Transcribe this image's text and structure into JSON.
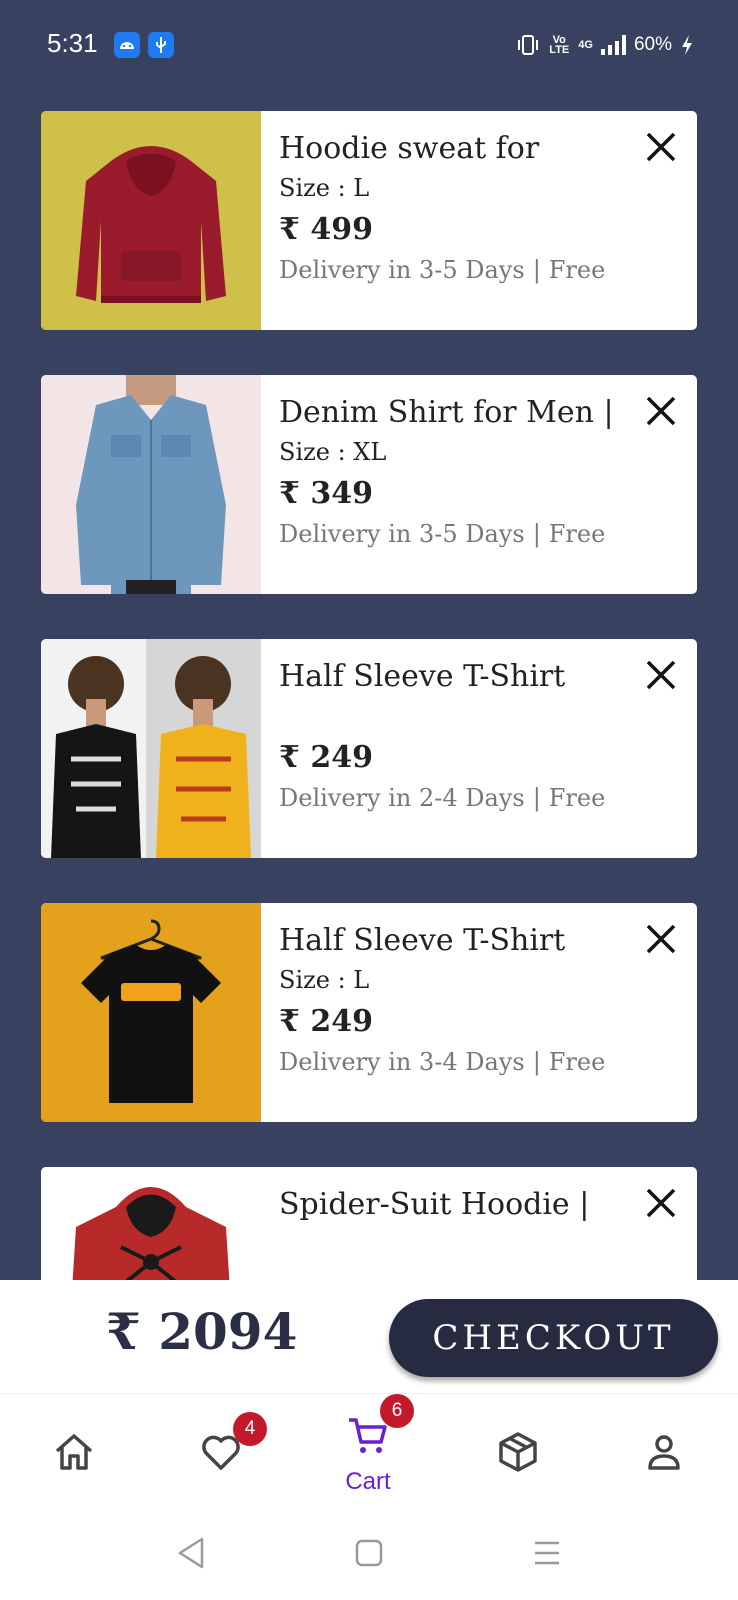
{
  "status_bar": {
    "time": "5:31",
    "network": "4G",
    "volte": "Vo LTE",
    "battery": "60%"
  },
  "cart": {
    "items": [
      {
        "title": "Hoodie sweat for",
        "size": "Size : L",
        "price": "₹ 499",
        "delivery": "Delivery in 3-5 Days",
        "shipping": "Free",
        "thumb_bg": "#cfc04a",
        "garment_color": "#9a1c2c"
      },
      {
        "title": "Denim Shirt for Men |",
        "size": "Size : XL",
        "price": "₹ 349",
        "delivery": "Delivery in 3-5 Days",
        "shipping": "Free",
        "thumb_bg": "#f3e5e5",
        "garment_color": "#6e97bd"
      },
      {
        "title": "Half Sleeve T-Shirt",
        "size": "",
        "price": "₹ 249",
        "delivery": "Delivery in 2-4 Days",
        "shipping": "Free",
        "thumb_bg": "#d6d6d6",
        "garment_color": "#f0b21c"
      },
      {
        "title": "Half Sleeve T-Shirt",
        "size": "Size : L",
        "price": "₹ 249",
        "delivery": "Delivery in 3-4 Days",
        "shipping": "Free",
        "thumb_bg": "#e4a21c",
        "garment_color": "#111111"
      },
      {
        "title": "Spider-Suit Hoodie |",
        "size": "",
        "price": "",
        "delivery": "",
        "shipping": "",
        "thumb_bg": "#ffffff",
        "garment_color": "#b82a2a"
      }
    ]
  },
  "checkout": {
    "total": "₹ 2094",
    "button_label": "CHECKOUT"
  },
  "bottom_nav": {
    "wishlist_badge": "4",
    "cart_badge": "6",
    "cart_label": "Cart",
    "active_color": "#6a1fd0"
  },
  "colors": {
    "background": "#38415f",
    "button": "#272b42",
    "badge": "#c21a2a"
  }
}
